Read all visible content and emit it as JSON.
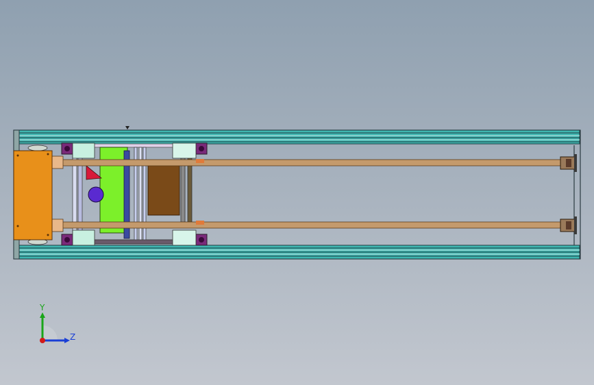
{
  "view": {
    "background_top": "#8fa0b0",
    "background_bottom": "#c2c7cf"
  },
  "colors": {
    "rail_teal": "#3fb6b0",
    "rail_dark": "#1f3b40",
    "rail_light": "#cfe8e8",
    "motor_orange": "#e8901a",
    "belt_tan": "#c49a6c",
    "bracket_mint": "#c8f0e0",
    "block_purple": "#7a2a7a",
    "plate_green": "#7cf02a",
    "plate_brown": "#7a4a18",
    "shaft_blue": "#3a4aa0",
    "disc_purple": "#5a2ad0",
    "wedge_red": "#d81a3a"
  },
  "triad": {
    "y_label": "Y",
    "z_label": "Z",
    "y_color": "#1aa51a",
    "z_color": "#1a3fd6",
    "x_color": "#d21a1a"
  },
  "marker_icon": "triangle-down-icon"
}
